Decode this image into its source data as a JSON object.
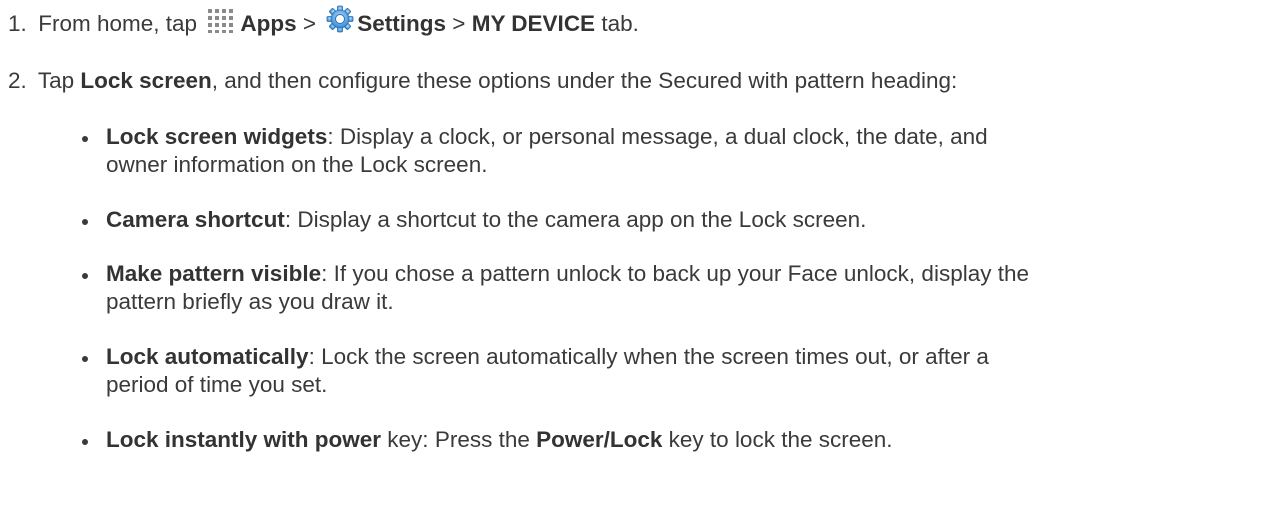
{
  "step1": {
    "number": "1.",
    "t1": "From home, tap",
    "apps": "Apps",
    "sep1": ">",
    "settings": "Settings",
    "sep2": ">",
    "tab": "MY DEVICE",
    "t2": "tab."
  },
  "step2": {
    "number": "2.",
    "t1": "Tap",
    "lock_screen": "Lock screen",
    "t2": ", and then configure these options under the Secured with pattern heading:"
  },
  "options": [
    {
      "term": "Lock screen widgets",
      "line1": ": Display a clock, or personal message, a dual clock, the date, and",
      "line2": "owner information on the Lock screen."
    },
    {
      "term": "Camera shortcut",
      "line1": ": Display a shortcut to the camera app on the Lock screen."
    },
    {
      "term": "Make pattern visible",
      "line1": ": If you chose a pattern unlock to back up your Face unlock, display the",
      "line2": "pattern briefly as you draw it."
    },
    {
      "term": "Lock automatically",
      "line1": ": Lock the screen automatically when the screen times out, or after a",
      "line2": "period of time you set."
    },
    {
      "term": "Lock instantly with power",
      "t1": " key: Press the ",
      "term2": "Power/Lock",
      "t2": " key to lock the screen."
    }
  ],
  "icons": {
    "apps": "apps-grid-icon",
    "settings": "settings-gear-icon"
  },
  "colors": {
    "text": "#3a3a3a",
    "apps_icon": "#8a8a8a",
    "settings_icon": "#3a8fd6"
  }
}
